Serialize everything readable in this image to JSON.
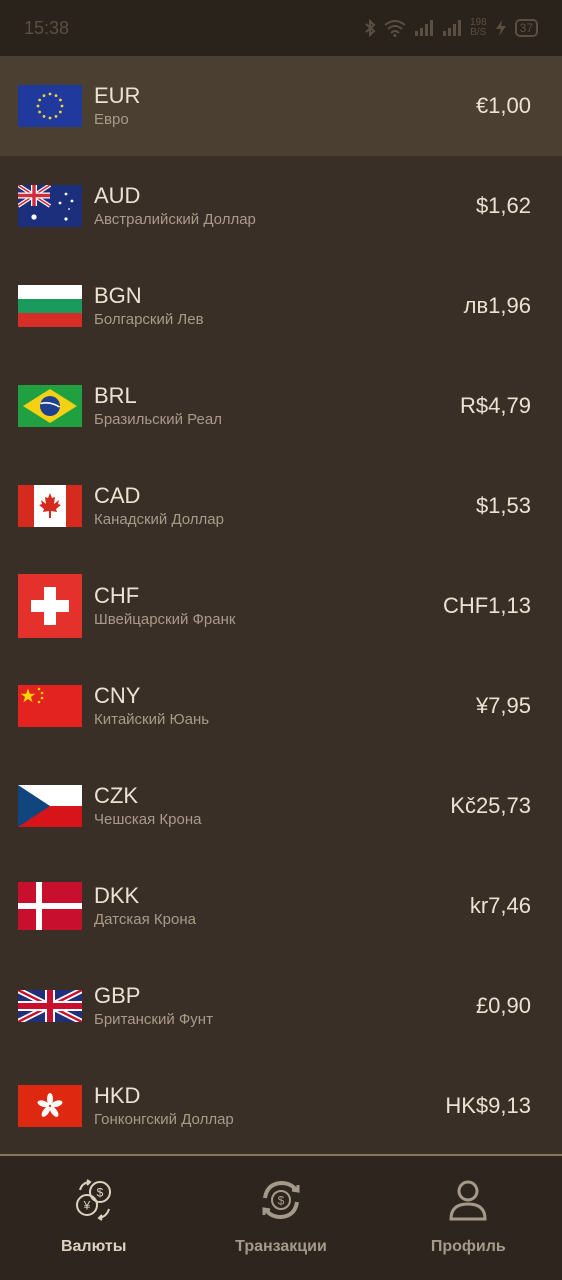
{
  "status_bar": {
    "time": "15:38",
    "net_speed_top": "198",
    "net_speed_bottom": "B/S",
    "battery": "37"
  },
  "currencies": [
    {
      "code": "EUR",
      "name": "Евро",
      "value": "€1,00",
      "flag": "eu-flag-icon"
    },
    {
      "code": "AUD",
      "name": "Австралийский Доллар",
      "value": "$1,62",
      "flag": "australia-flag-icon"
    },
    {
      "code": "BGN",
      "name": "Болгарский Лев",
      "value": "лв1,96",
      "flag": "bulgaria-flag-icon"
    },
    {
      "code": "BRL",
      "name": "Бразильский Реал",
      "value": "R$4,79",
      "flag": "brazil-flag-icon"
    },
    {
      "code": "CAD",
      "name": "Канадский Доллар",
      "value": "$1,53",
      "flag": "canada-flag-icon"
    },
    {
      "code": "CHF",
      "name": "Швейцарский Франк",
      "value": "CHF1,13",
      "flag": "switzerland-flag-icon"
    },
    {
      "code": "CNY",
      "name": "Китайский Юань",
      "value": "¥7,95",
      "flag": "china-flag-icon"
    },
    {
      "code": "CZK",
      "name": "Чешская Крона",
      "value": "Kč25,73",
      "flag": "czech-flag-icon"
    },
    {
      "code": "DKK",
      "name": "Датская Крона",
      "value": "kr7,46",
      "flag": "denmark-flag-icon"
    },
    {
      "code": "GBP",
      "name": "Британский Фунт",
      "value": "£0,90",
      "flag": "uk-flag-icon"
    },
    {
      "code": "HKD",
      "name": "Гонконгский Доллар",
      "value": "HK$9,13",
      "flag": "hong-kong-flag-icon"
    }
  ],
  "nav": {
    "currencies": "Валюты",
    "transactions": "Транзакции",
    "profile": "Профиль"
  },
  "colors": {
    "background": "#392f26",
    "selected_row": "#4b3f31",
    "nav_background": "#2e261e",
    "accent_line": "#8a7556"
  }
}
